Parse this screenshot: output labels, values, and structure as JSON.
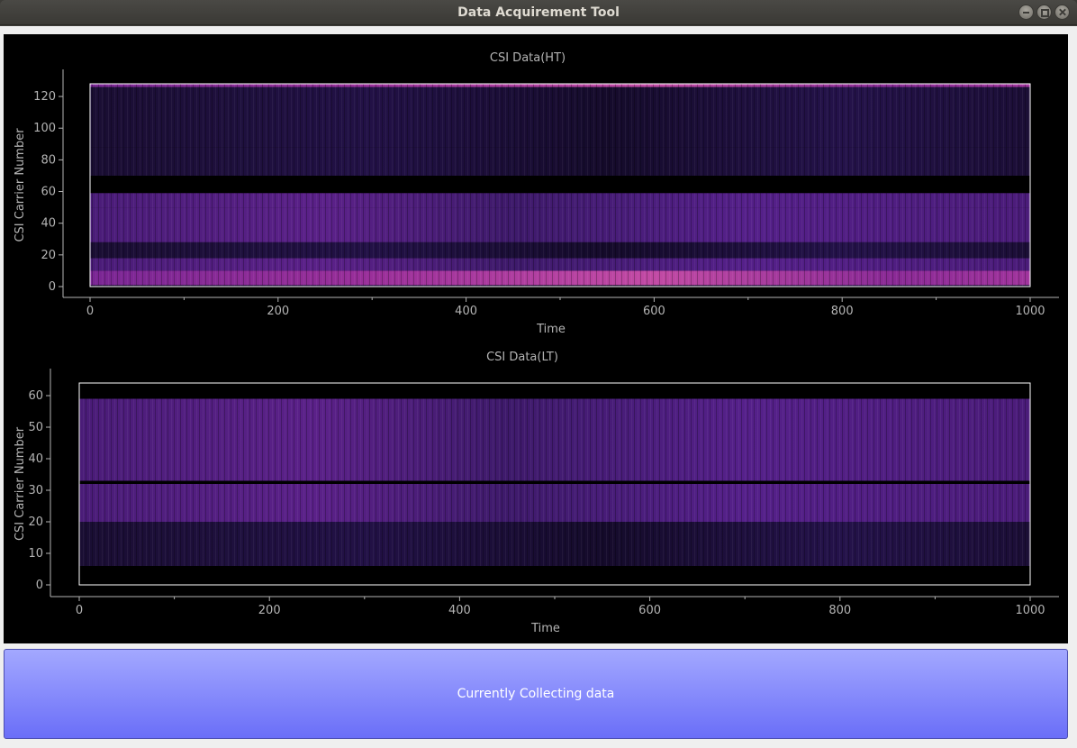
{
  "window": {
    "title": "Data Acquirement Tool"
  },
  "icons": [
    "minimize-icon",
    "maximize-icon",
    "close-icon"
  ],
  "button": {
    "label": "Currently Collecting data"
  },
  "colors": {
    "plot_background": "#000000",
    "axis_text": "#b4b4b4",
    "frame": "#ffffff",
    "heatmap_dark": "#10081e",
    "heatmap_mid": "#3f1a66",
    "heatmap_bright": "#8a2a96",
    "button_top": "#a3a8ff",
    "button_bottom": "#6a6ef8"
  },
  "chart_data": [
    {
      "type": "heatmap",
      "title": "CSI Data(HT)",
      "xlabel": "Time",
      "ylabel": "CSI Carrier Number",
      "xlim": [
        0,
        1000
      ],
      "ylim": [
        0,
        128
      ],
      "xticks": [
        "0",
        "200",
        "400",
        "600",
        "800",
        "1000"
      ],
      "yticks": [
        "0",
        "20",
        "40",
        "60",
        "80",
        "100",
        "120"
      ],
      "colormap": "magma",
      "bands": [
        {
          "y0": 0,
          "y1": 1,
          "level": "dark"
        },
        {
          "y0": 1,
          "y1": 10,
          "level": "bright"
        },
        {
          "y0": 10,
          "y1": 18,
          "level": "mid"
        },
        {
          "y0": 18,
          "y1": 28,
          "level": "dark"
        },
        {
          "y0": 28,
          "y1": 50,
          "level": "mid"
        },
        {
          "y0": 50,
          "y1": 59,
          "level": "mid"
        },
        {
          "y0": 59,
          "y1": 70,
          "level": "null"
        },
        {
          "y0": 70,
          "y1": 88,
          "level": "dark"
        },
        {
          "y0": 88,
          "y1": 126,
          "level": "dark"
        },
        {
          "y0": 126,
          "y1": 128,
          "level": "bright"
        }
      ]
    },
    {
      "type": "heatmap",
      "title": "CSI Data(LT)",
      "xlabel": "Time",
      "ylabel": "CSI Carrier Number",
      "xlim": [
        0,
        1000
      ],
      "ylim": [
        0,
        64
      ],
      "xticks": [
        "0",
        "200",
        "400",
        "600",
        "800",
        "1000"
      ],
      "yticks": [
        "0",
        "10",
        "20",
        "30",
        "40",
        "50",
        "60"
      ],
      "colormap": "magma",
      "bands": [
        {
          "y0": 0,
          "y1": 6,
          "level": "null"
        },
        {
          "y0": 6,
          "y1": 20,
          "level": "dark"
        },
        {
          "y0": 20,
          "y1": 32,
          "level": "mid"
        },
        {
          "y0": 32,
          "y1": 33,
          "level": "null"
        },
        {
          "y0": 33,
          "y1": 59,
          "level": "mid"
        },
        {
          "y0": 59,
          "y1": 64,
          "level": "null"
        }
      ]
    }
  ]
}
